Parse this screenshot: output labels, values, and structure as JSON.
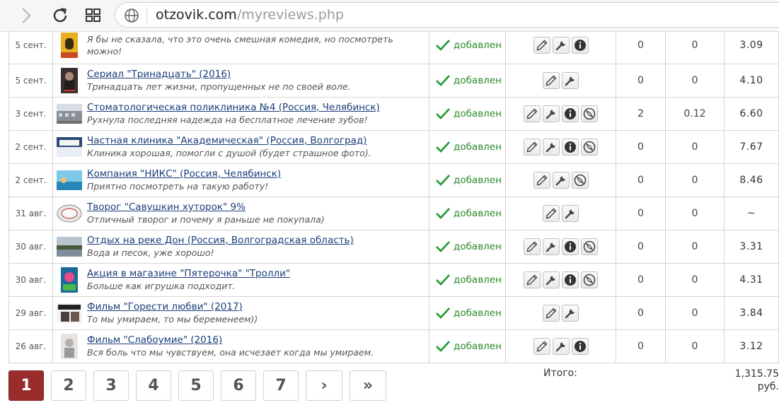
{
  "browser": {
    "url_domain": "otzovik.com",
    "url_path": "/myreviews.php"
  },
  "reviews": [
    {
      "date": "5 сент.",
      "title": "",
      "subtitle": "Я бы не сказала, что это очень смешная комедия, но посмотреть можно!",
      "status": "добавлен",
      "tools": [
        "pencil-icon",
        "wrench-icon",
        "info-icon"
      ],
      "n1": "0",
      "n2": "0",
      "n3": "3.09",
      "thumb": "poster-yellow"
    },
    {
      "date": "5 сент.",
      "title": "Сериал \"Тринадцать\" (2016)",
      "subtitle": "Тринадцать лет жизни, пропущенных не по своей воле.",
      "status": "добавлен",
      "tools": [
        "pencil-icon",
        "wrench-icon"
      ],
      "n1": "0",
      "n2": "0",
      "n3": "4.10",
      "thumb": "poster-dark"
    },
    {
      "date": "3 сент.",
      "title": "Стоматологическая поликлиника №4 (Россия, Челябинск)",
      "subtitle": "Рухнула последняя надежда на бесплатное лечение зубов!",
      "status": "добавлен",
      "tools": [
        "pencil-icon",
        "wrench-icon",
        "info-icon",
        "compass-icon"
      ],
      "n1": "2",
      "n2": "0.12",
      "n3": "6.60",
      "thumb": "building"
    },
    {
      "date": "2 сент.",
      "title": "Частная клиника \"Академическая\" (Россия, Волгоград)",
      "subtitle": "Клиника хорошая, помогли с душой (будет страшное фото).",
      "status": "добавлен",
      "tools": [
        "pencil-icon",
        "wrench-icon",
        "info-icon",
        "compass-icon"
      ],
      "n1": "0",
      "n2": "0",
      "n3": "7.67",
      "thumb": "clinic"
    },
    {
      "date": "2 сент.",
      "title": "Компания \"НИКС\" (Россия, Челябинск)",
      "subtitle": "Приятно посмотреть на такую работу!",
      "status": "добавлен",
      "tools": [
        "pencil-icon",
        "wrench-icon",
        "compass-icon"
      ],
      "n1": "0",
      "n2": "0",
      "n3": "8.46",
      "thumb": "sea"
    },
    {
      "date": "31 авг.",
      "title": "Творог \"Савушкин хуторок\" 9%",
      "subtitle": "Отличный творог и почему я раньше не покупала)",
      "status": "добавлен",
      "tools": [
        "pencil-icon",
        "wrench-icon"
      ],
      "n1": "0",
      "n2": "0",
      "n3": "~",
      "thumb": "package"
    },
    {
      "date": "30 авг.",
      "title": "Отдых на реке Дон (Россия, Волгоградская область)",
      "subtitle": "Вода и песок, уже хорошо!",
      "status": "добавлен",
      "tools": [
        "pencil-icon",
        "wrench-icon",
        "info-icon",
        "compass-icon"
      ],
      "n1": "0",
      "n2": "0",
      "n3": "3.31",
      "thumb": "river"
    },
    {
      "date": "30 авг.",
      "title": "Акция в магазине \"Пятерочка\" \"Тролли\"",
      "subtitle": "Больше как игрушка подходит.",
      "status": "добавлен",
      "tools": [
        "pencil-icon",
        "wrench-icon",
        "info-icon",
        "compass-icon"
      ],
      "n1": "0",
      "n2": "0",
      "n3": "4.31",
      "thumb": "toy"
    },
    {
      "date": "29 авг.",
      "title": "Фильм \"Горести любви\" (2017)",
      "subtitle": "То мы умираем, то мы беременеем))",
      "status": "добавлен",
      "tools": [
        "pencil-icon",
        "wrench-icon"
      ],
      "n1": "0",
      "n2": "0",
      "n3": "3.84",
      "thumb": "movie"
    },
    {
      "date": "26 авг.",
      "title": "Фильм \"Слабоумие\" (2016)",
      "subtitle": "Вся боль что мы чувствуем, она исчезает когда мы умираем.",
      "status": "добавлен",
      "tools": [
        "pencil-icon",
        "wrench-icon",
        "info-icon"
      ],
      "n1": "0",
      "n2": "0",
      "n3": "3.12",
      "thumb": "portrait-light"
    }
  ],
  "pagination": {
    "pages": [
      "1",
      "2",
      "3",
      "4",
      "5",
      "6",
      "7"
    ],
    "active": "1",
    "next": "›",
    "last": "»"
  },
  "totals": {
    "label": "Итого:",
    "value_line1": "1,315.75",
    "value_line2": "руб."
  },
  "colors": {
    "link": "#1a3d7a",
    "status_green": "#2a8a2a",
    "active_page": "#9b2c2c"
  }
}
